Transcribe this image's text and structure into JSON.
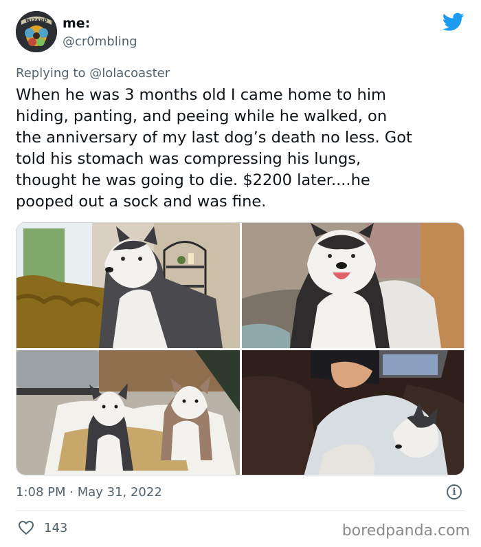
{
  "tweet": {
    "display_name": "me:",
    "handle": "@cr0mbling",
    "avatar_label": "WIZARD",
    "replying_prefix": "Replying to",
    "replying_to": "@lolacoaster",
    "text": "When he was 3 months old I came home to him\nhiding, panting, and peeing while he walked, on\nthe anniversary of my last dog’s death no less. Got\ntold his stomach was compressing his lungs,\nthought he was going to die. $2200 later....he\npooped out a sock and was fine.",
    "timestamp": "1:08 PM · May 31, 2022",
    "likes": "143"
  },
  "icons": {
    "brand": "twitter-bird-icon",
    "info": "info-icon",
    "like": "heart-icon"
  },
  "colors": {
    "twitter_blue": "#1d9bf0",
    "secondary_text": "#536471",
    "primary_text": "#0f1419"
  },
  "watermark": "boredpanda.com"
}
